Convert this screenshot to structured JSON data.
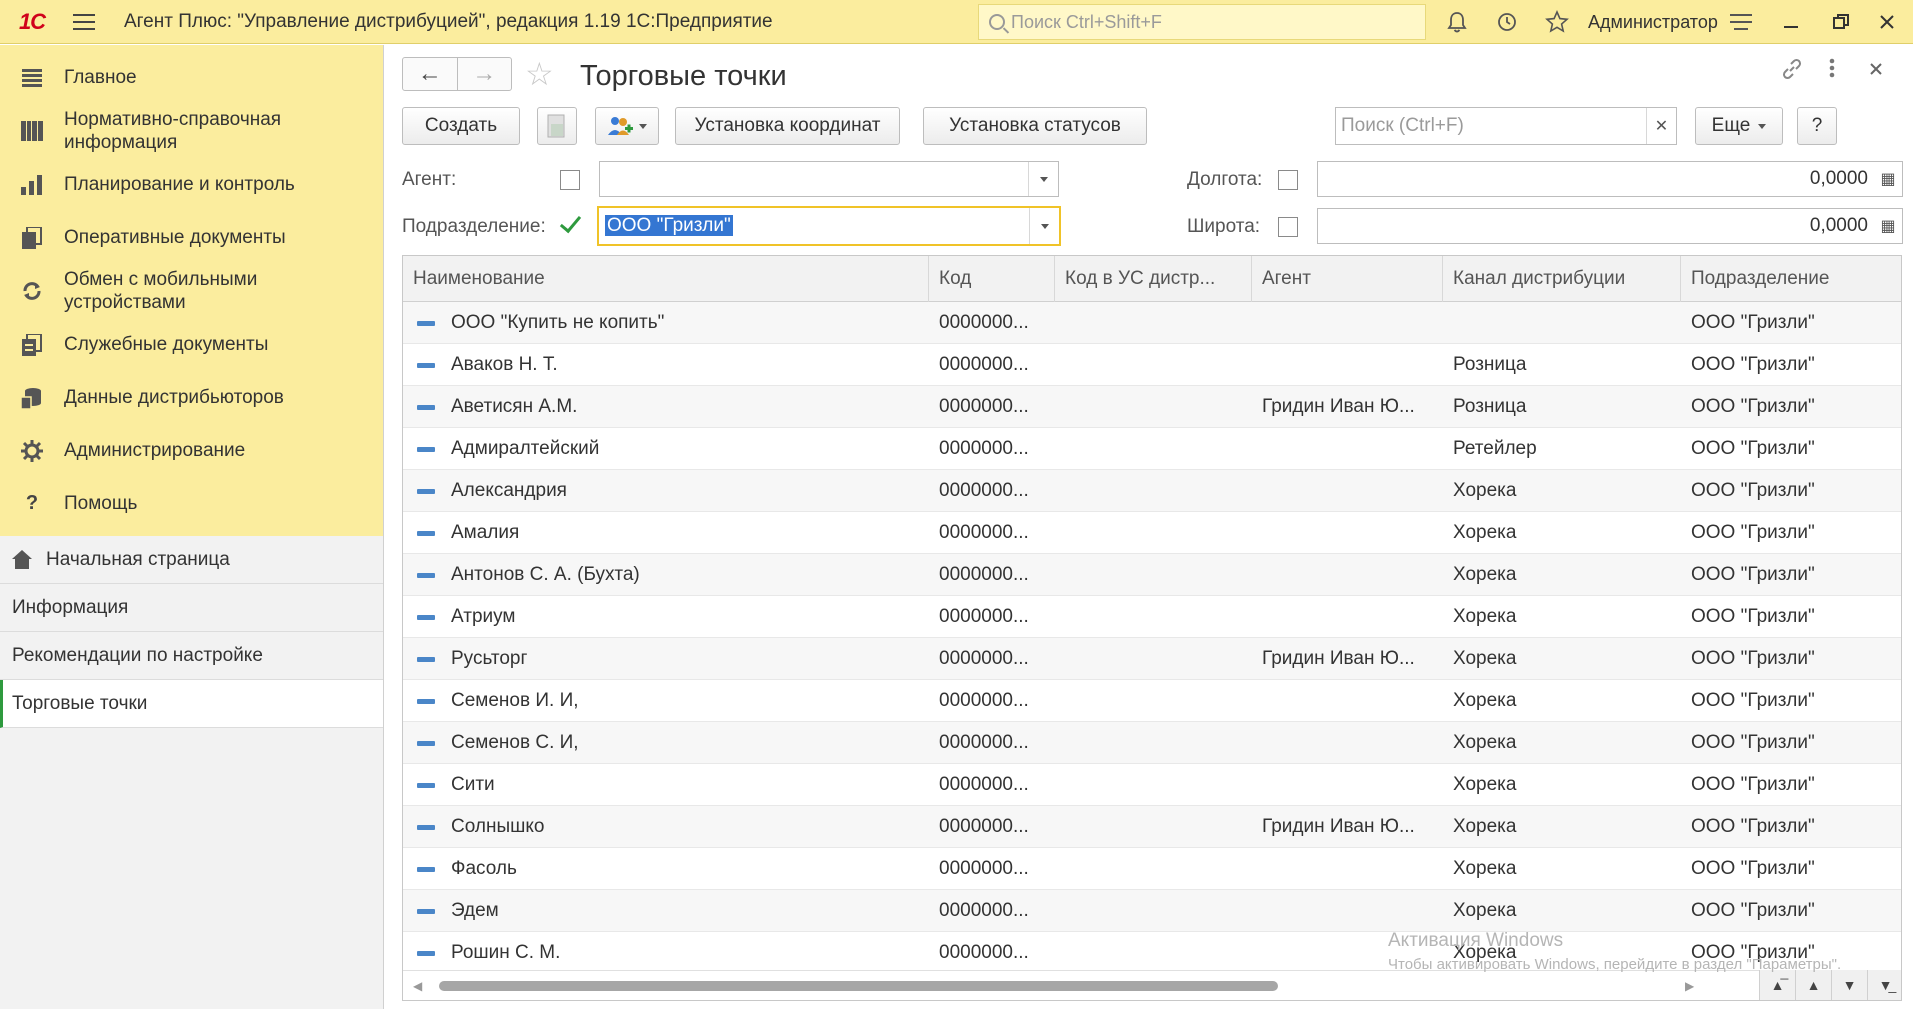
{
  "app": {
    "logo": "1С",
    "title": "Агент Плюс: \"Управление дистрибуцией\", редакция 1.19 1С:Предприятие",
    "search_placeholder": "Поиск Ctrl+Shift+F",
    "user": "Администратор"
  },
  "sidebar": {
    "sections": [
      {
        "label": "Главное",
        "icon": "menu-list-icon"
      },
      {
        "label": "Нормативно-справочная информация",
        "icon": "catalog-icon"
      },
      {
        "label": "Планирование и контроль",
        "icon": "chart-icon"
      },
      {
        "label": "Оперативные документы",
        "icon": "documents-icon"
      },
      {
        "label": "Обмен с мобильными устройствами",
        "icon": "sync-icon"
      },
      {
        "label": "Служебные документы",
        "icon": "service-docs-icon"
      },
      {
        "label": "Данные дистрибьюторов",
        "icon": "distributor-data-icon"
      },
      {
        "label": "Администрирование",
        "icon": "gear-icon"
      },
      {
        "label": "Помощь",
        "icon": "help-icon"
      }
    ],
    "open_windows": [
      {
        "label": "Начальная страница"
      },
      {
        "label": "Информация"
      },
      {
        "label": "Рекомендации по настройке"
      },
      {
        "label": "Торговые точки"
      }
    ]
  },
  "form": {
    "title": "Торговые точки",
    "buttons": {
      "create": "Создать",
      "set_coords": "Установка координат",
      "set_status": "Установка статусов",
      "more": "Еще",
      "help": "?"
    },
    "search_placeholder": "Поиск (Ctrl+F)",
    "filters": {
      "agent_label": "Агент:",
      "agent_value": "",
      "agent_checked": false,
      "division_label": "Подразделение:",
      "division_value": "ООО \"Гризли\"",
      "division_checked": true,
      "longitude_label": "Долгота:",
      "longitude_value": "0,0000",
      "latitude_label": "Широта:",
      "latitude_value": "0,0000"
    }
  },
  "table": {
    "columns": [
      "Наименование",
      "Код",
      "Код в УС дистр...",
      "Агент",
      "Канал дистрибуции",
      "Подразделение"
    ],
    "rows": [
      [
        "ООО \"Купить не копить\"",
        "0000000...",
        "",
        "",
        "",
        "ООО \"Гризли\""
      ],
      [
        "Аваков Н. Т.",
        "0000000...",
        "",
        "",
        "Розница",
        "ООО \"Гризли\""
      ],
      [
        "Аветисян А.М.",
        "0000000...",
        "",
        "Гридин Иван Ю...",
        "Розница",
        "ООО \"Гризли\""
      ],
      [
        "Адмиралтейский",
        "0000000...",
        "",
        "",
        "Ретейлер",
        "ООО \"Гризли\""
      ],
      [
        "Александрия",
        "0000000...",
        "",
        "",
        "Хорека",
        "ООО \"Гризли\""
      ],
      [
        "Амалия",
        "0000000...",
        "",
        "",
        "Хорека",
        "ООО \"Гризли\""
      ],
      [
        "Антонов С. А. (Бухта)",
        "0000000...",
        "",
        "",
        "Хорека",
        "ООО \"Гризли\""
      ],
      [
        "Атриум",
        "0000000...",
        "",
        "",
        "Хорека",
        "ООО \"Гризли\""
      ],
      [
        "Русьторг",
        "0000000...",
        "",
        "Гридин Иван Ю...",
        "Хорека",
        "ООО \"Гризли\""
      ],
      [
        "Семенов И. И,",
        "0000000...",
        "",
        "",
        "Хорека",
        "ООО \"Гризли\""
      ],
      [
        "Семенов С. И,",
        "0000000...",
        "",
        "",
        "Хорека",
        "ООО \"Гризли\""
      ],
      [
        "Сити",
        "0000000...",
        "",
        "",
        "Хорека",
        "ООО \"Гризли\""
      ],
      [
        "Солнышко",
        "0000000...",
        "",
        "Гридин Иван Ю...",
        "Хорека",
        "ООО \"Гризли\""
      ],
      [
        "Фасоль",
        "0000000...",
        "",
        "",
        "Хорека",
        "ООО \"Гризли\""
      ],
      [
        "Эдем",
        "0000000...",
        "",
        "",
        "Хорека",
        "ООО \"Гризли\""
      ],
      [
        "Рошин С. М.",
        "0000000...",
        "",
        "",
        "Хорека",
        "ООО \"Гризли\""
      ]
    ]
  },
  "watermark": {
    "line1": "Активация Windows",
    "line2": "Чтобы активировать Windows, перейдите в раздел \"Параметры\"."
  }
}
